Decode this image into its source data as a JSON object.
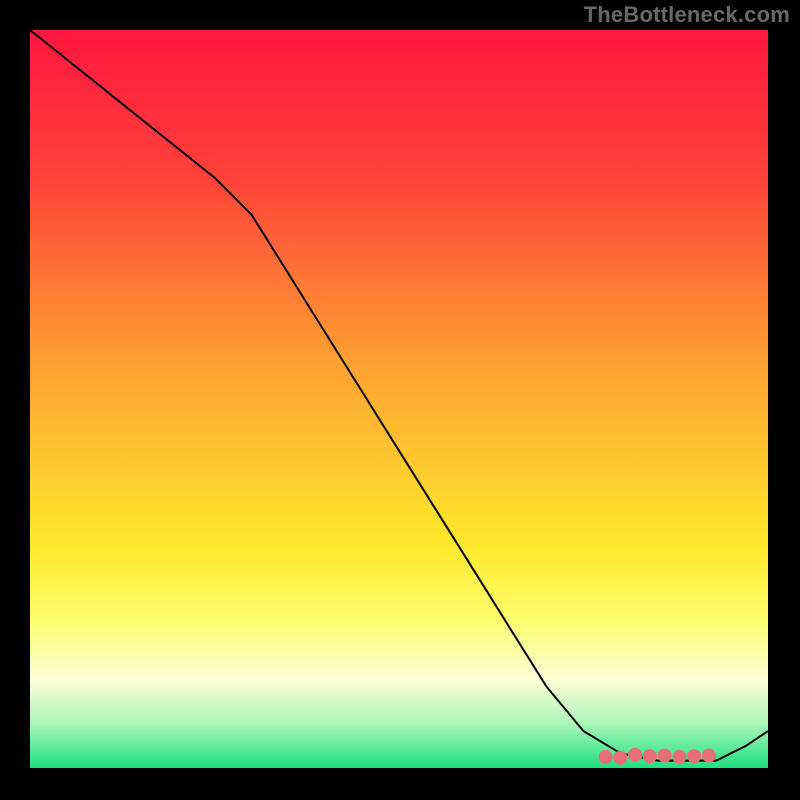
{
  "attribution": "TheBottleneck.com",
  "chart_data": {
    "type": "line",
    "title": "",
    "xlabel": "",
    "ylabel": "",
    "xlim": [
      0,
      100
    ],
    "ylim": [
      0,
      100
    ],
    "grid": false,
    "legend": false,
    "background": {
      "orientation": "vertical",
      "stops": [
        {
          "pos": 0,
          "color": "#ff173f"
        },
        {
          "pos": 20,
          "color": "#ff4239"
        },
        {
          "pos": 45,
          "color": "#ffa032"
        },
        {
          "pos": 70,
          "color": "#ffe92c"
        },
        {
          "pos": 80,
          "color": "#fdfe70"
        },
        {
          "pos": 88,
          "color": "#fdfed6"
        },
        {
          "pos": 94,
          "color": "#acf6b6"
        },
        {
          "pos": 100,
          "color": "#1ee080"
        }
      ]
    },
    "series": [
      {
        "name": "curve",
        "color": "#000000",
        "stroke_width": 2,
        "x": [
          0,
          5,
          10,
          15,
          20,
          25,
          30,
          35,
          40,
          45,
          50,
          55,
          60,
          65,
          70,
          75,
          80,
          85,
          87,
          90,
          93,
          95,
          97,
          100
        ],
        "y": [
          100,
          96,
          92,
          88,
          84,
          80,
          75,
          67,
          59,
          51,
          43,
          35,
          27,
          19,
          11,
          5,
          2,
          1,
          1,
          1,
          1,
          2,
          3,
          5
        ]
      }
    ],
    "markers": {
      "name": "highlight-band",
      "color": "#e86f75",
      "x": [
        78,
        80,
        82,
        84,
        86,
        88,
        90,
        92
      ],
      "y": [
        1.5,
        1.4,
        1.8,
        1.6,
        1.7,
        1.5,
        1.6,
        1.7
      ],
      "size": 7
    }
  }
}
